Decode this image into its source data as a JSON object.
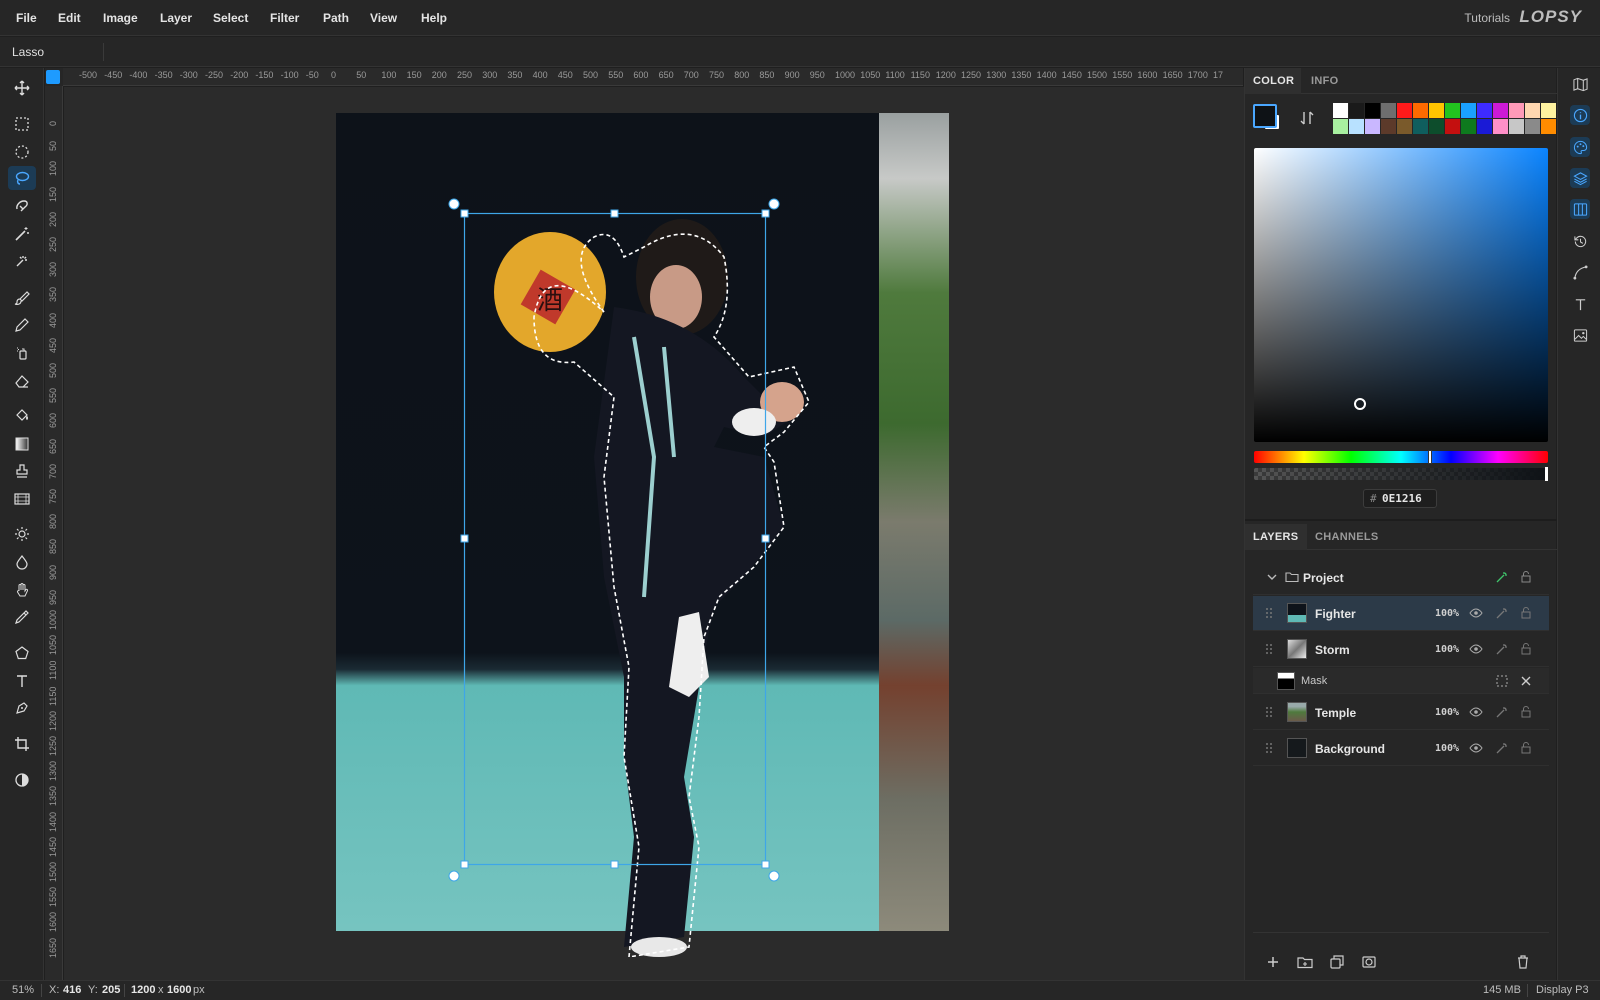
{
  "menu": [
    "File",
    "Edit",
    "Image",
    "Layer",
    "Select",
    "Filter",
    "Path",
    "View",
    "Help"
  ],
  "header": {
    "tutorials": "Tutorials",
    "logo": "LOPSY"
  },
  "options": {
    "tool_name": "Lasso"
  },
  "rulers": {
    "top": [
      "-500",
      "-450",
      "-400",
      "-350",
      "-300",
      "-250",
      "-200",
      "-150",
      "-100",
      "-50",
      "0",
      "50",
      "100",
      "150",
      "200",
      "250",
      "300",
      "350",
      "400",
      "450",
      "500",
      "550",
      "600",
      "650",
      "700",
      "750",
      "800",
      "850",
      "900",
      "950",
      "1000",
      "1050",
      "1100",
      "1150",
      "1200",
      "1250",
      "1300",
      "1350",
      "1400",
      "1450",
      "1500",
      "1550",
      "1600",
      "1650",
      "1700",
      "17"
    ],
    "left": [
      "0",
      "50",
      "100",
      "150",
      "200",
      "250",
      "300",
      "350",
      "400",
      "450",
      "500",
      "550",
      "600",
      "650",
      "700",
      "750",
      "800",
      "850",
      "900",
      "950",
      "1000",
      "1050",
      "1100",
      "1150",
      "1200",
      "1250",
      "1300",
      "1350",
      "1400",
      "1450",
      "1500",
      "1550",
      "1600",
      "1650"
    ]
  },
  "status": {
    "zoom": "51%",
    "x_label": "X:",
    "x_value": "416",
    "y_label": "Y:",
    "y_value": "205",
    "width": "1200",
    "times": "x",
    "height": "1600",
    "unit": "px",
    "memory": "145 MB",
    "profile": "Display P3"
  },
  "color_panel": {
    "tabs": [
      "COLOR",
      "INFO"
    ],
    "hex_hash": "#",
    "hex": "0E1216",
    "hue_fraction": 0.6,
    "sv_point": {
      "saturation": 0.36,
      "value": 0.09
    },
    "palette": [
      "#ffffff",
      "#1a1a1a",
      "#000000",
      "#6e6e6e",
      "#ff1a1a",
      "#ff6a00",
      "#ffc400",
      "#22c31f",
      "#1aa1ff",
      "#3e2bff",
      "#cc1ad6",
      "#ff9ab8",
      "#ffd7b0",
      "#fff3a0",
      "#a8f0a0",
      "#b8e1ff",
      "#c9b7ff",
      "#5c3a2a",
      "#7a5a2b",
      "#0f5e5e",
      "#0d4d2c",
      "#c40f0f",
      "#0e7a1e",
      "#1a1ad6",
      "#ff8fc8",
      "#c7c7c7",
      "#8a8a8a",
      "#ff8c00"
    ]
  },
  "layers_panel": {
    "tabs": [
      "LAYERS",
      "CHANNELS"
    ],
    "group": {
      "name": "Project"
    },
    "layers": [
      {
        "name": "Fighter",
        "opacity": "100%"
      },
      {
        "name": "Storm",
        "opacity": "100%"
      },
      {
        "name": "Temple",
        "opacity": "100%"
      },
      {
        "name": "Background",
        "opacity": "100%"
      }
    ],
    "mask": {
      "name": "Mask"
    }
  }
}
